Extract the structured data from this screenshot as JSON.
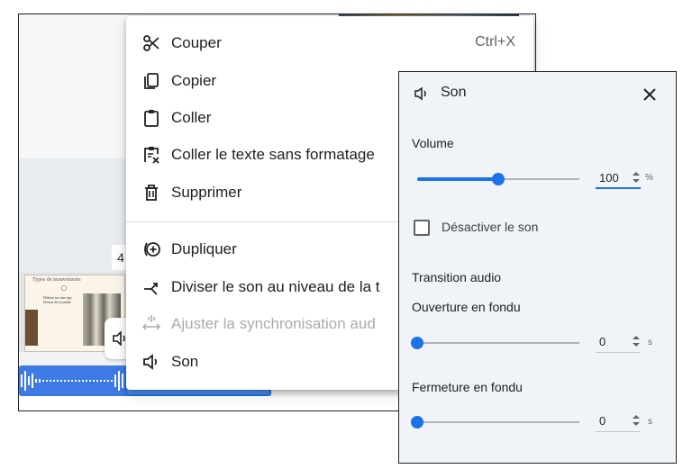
{
  "background": {
    "timestamp_digit": "4",
    "slide_title": "Types de mouvements",
    "slide_text": "Debout sur une tige, flexion de la jambe"
  },
  "context_menu": {
    "items": [
      {
        "label": "Couper",
        "shortcut": "Ctrl+X",
        "icon": "scissors-icon",
        "disabled": false
      },
      {
        "label": "Copier",
        "shortcut": "",
        "icon": "copy-icon",
        "disabled": false
      },
      {
        "label": "Coller",
        "shortcut": "",
        "icon": "paste-icon",
        "disabled": false
      },
      {
        "label": "Coller le texte sans formatage",
        "shortcut": "",
        "icon": "paste-plain-icon",
        "disabled": false
      },
      {
        "label": "Supprimer",
        "shortcut": "",
        "icon": "trash-icon",
        "disabled": false
      },
      {
        "label": "Dupliquer",
        "shortcut": "",
        "icon": "duplicate-icon",
        "disabled": false
      },
      {
        "label": "Diviser le son au niveau de la t",
        "shortcut": "",
        "icon": "split-icon",
        "disabled": false
      },
      {
        "label": "Ajuster la synchronisation aud",
        "shortcut": "",
        "icon": "sync-icon",
        "disabled": true
      },
      {
        "label": "Son",
        "shortcut": "",
        "icon": "volume-icon",
        "disabled": false
      }
    ]
  },
  "son_panel": {
    "title": "Son",
    "volume": {
      "label": "Volume",
      "value": "100",
      "unit": "%",
      "level": 0.5
    },
    "mute": {
      "label": "Désactiver le son",
      "checked": false
    },
    "transition": {
      "title": "Transition audio",
      "fade_in": {
        "label": "Ouverture en fondu",
        "value": "0",
        "unit": "s",
        "level": 0
      },
      "fade_out": {
        "label": "Fermeture en fondu",
        "value": "0",
        "unit": "s",
        "level": 0
      }
    }
  },
  "colors": {
    "accent": "#1a73e8",
    "panel_bg": "#f0f4f9",
    "track": "#3d7ae4"
  }
}
